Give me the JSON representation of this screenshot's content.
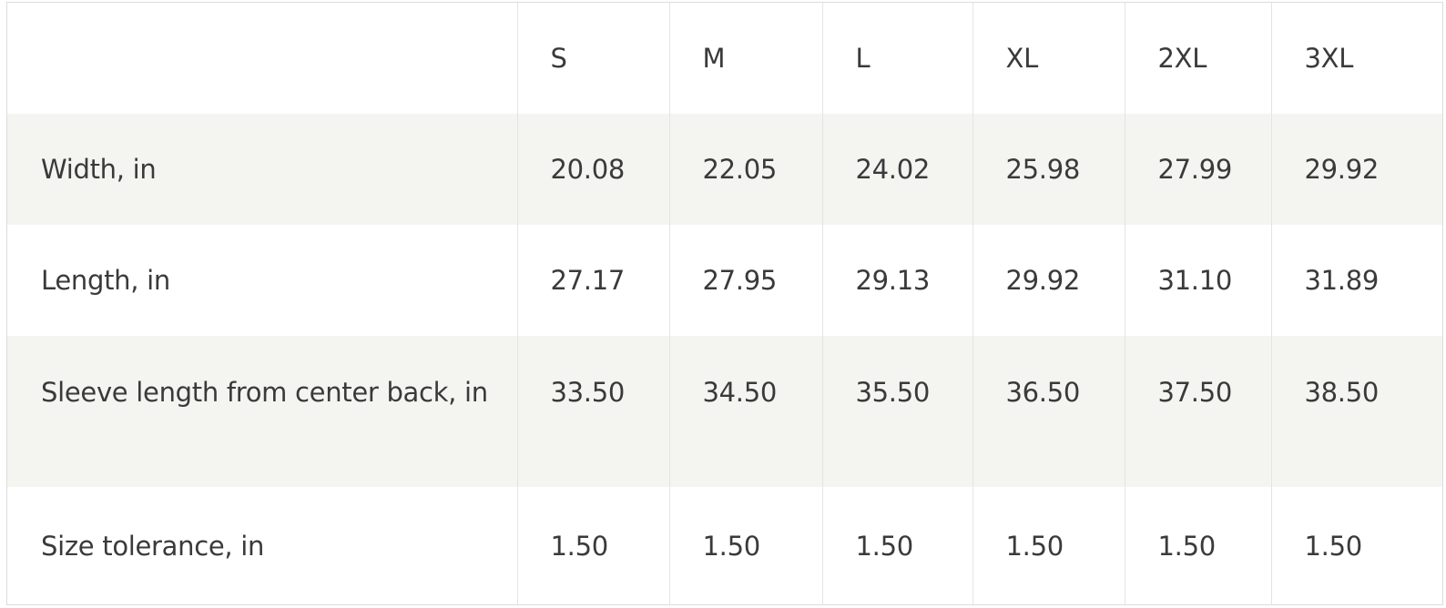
{
  "size_chart": {
    "sizes": [
      "S",
      "M",
      "L",
      "XL",
      "2XL",
      "3XL"
    ],
    "rows": [
      {
        "label": "Width, in",
        "values": [
          "20.08",
          "22.05",
          "24.02",
          "25.98",
          "27.99",
          "29.92"
        ]
      },
      {
        "label": "Length, in",
        "values": [
          "27.17",
          "27.95",
          "29.13",
          "29.92",
          "31.10",
          "31.89"
        ]
      },
      {
        "label": "Sleeve length from center back, in",
        "values": [
          "33.50",
          "34.50",
          "35.50",
          "36.50",
          "37.50",
          "38.50"
        ]
      },
      {
        "label": "Size tolerance, in",
        "values": [
          "1.50",
          "1.50",
          "1.50",
          "1.50",
          "1.50",
          "1.50"
        ]
      }
    ]
  }
}
